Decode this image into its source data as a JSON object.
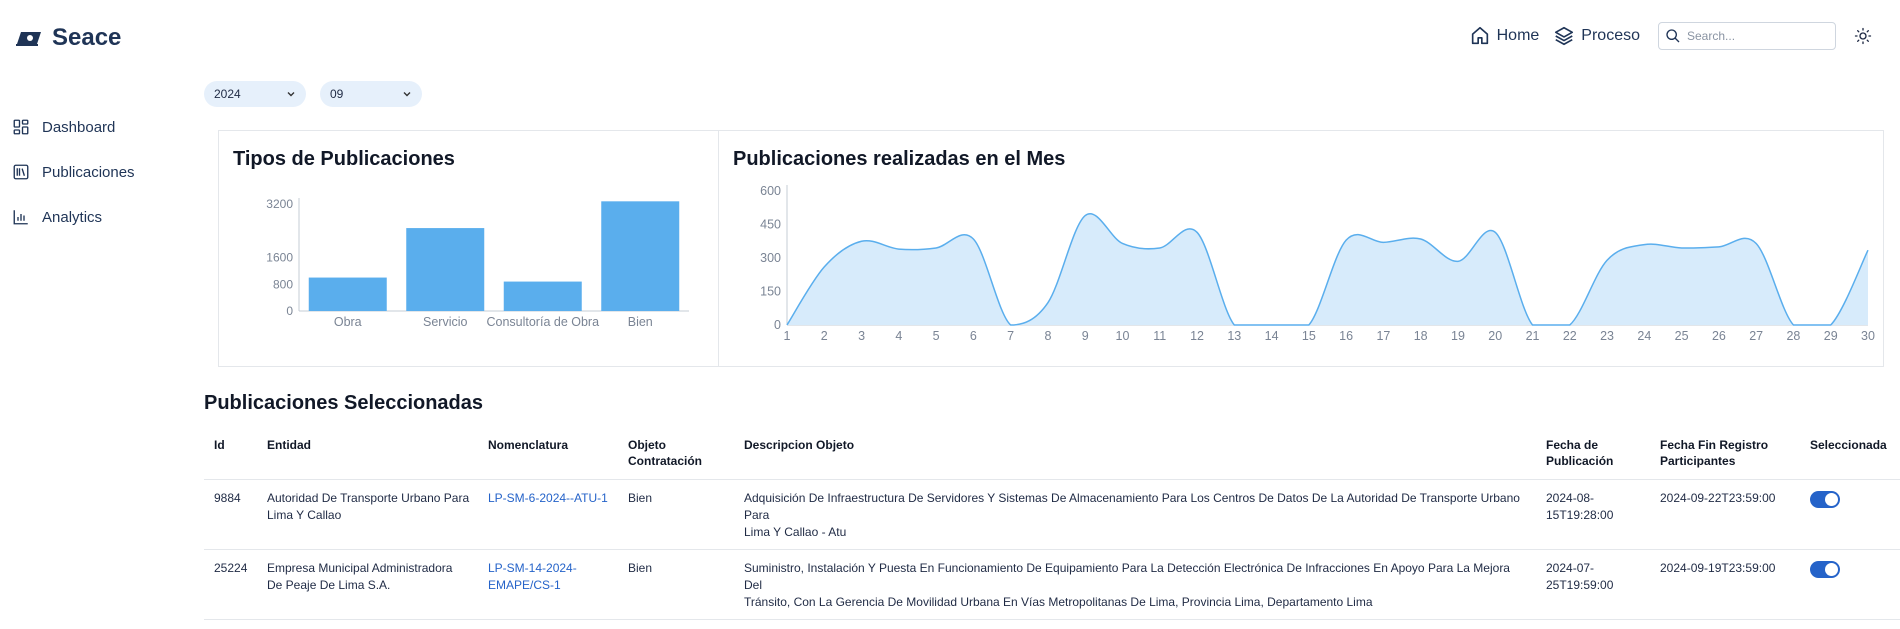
{
  "app": {
    "name": "Seace"
  },
  "topnav": {
    "home_label": "Home",
    "proceso_label": "Proceso",
    "search_placeholder": "Search..."
  },
  "sidebar": {
    "items": [
      {
        "label": "Dashboard",
        "icon": "dashboard-icon"
      },
      {
        "label": "Publicaciones",
        "icon": "library-icon"
      },
      {
        "label": "Analytics",
        "icon": "bar-chart-icon"
      }
    ]
  },
  "filters": {
    "year": "2024",
    "month": "09"
  },
  "colors": {
    "bar": "#5aaeed",
    "area_fill": "#d7ebfb",
    "area_line": "#5aaeed",
    "accent": "#2563c9"
  },
  "chart_data": [
    {
      "type": "bar",
      "title": "Tipos de Publicaciones",
      "categories": [
        "Obra",
        "Servicio",
        "Consultoría de Obra",
        "Bien"
      ],
      "values": [
        1000,
        2480,
        880,
        3280
      ],
      "yticks": [
        0,
        800,
        1600,
        3200
      ],
      "ylim": [
        0,
        3200
      ]
    },
    {
      "type": "area",
      "title": "Publicaciones realizadas en el Mes",
      "x": [
        1,
        2,
        3,
        4,
        5,
        6,
        7,
        8,
        9,
        10,
        11,
        12,
        13,
        14,
        15,
        16,
        17,
        18,
        19,
        20,
        21,
        22,
        23,
        24,
        25,
        26,
        27,
        28,
        29,
        30
      ],
      "values": [
        0,
        260,
        375,
        340,
        345,
        385,
        0,
        100,
        490,
        365,
        345,
        415,
        0,
        0,
        0,
        380,
        370,
        385,
        285,
        415,
        0,
        0,
        290,
        360,
        345,
        350,
        365,
        0,
        0,
        335
      ],
      "yticks": [
        0,
        150,
        300,
        450,
        600
      ],
      "ylim": [
        0,
        600
      ]
    }
  ],
  "table": {
    "title": "Publicaciones Seleccionadas",
    "headers": {
      "id": "Id",
      "entidad": "Entidad",
      "nomenclatura": "Nomenclatura",
      "objeto_1": "Objeto",
      "objeto_2": "Contratación",
      "descripcion": "Descripcion Objeto",
      "fecha_1": "Fecha de",
      "fecha_2": "Publicación",
      "fin_1": "Fecha Fin Registro",
      "fin_2": "Participantes",
      "seleccionada": "Seleccionada"
    },
    "rows": [
      {
        "id": "9884",
        "entidad_1": "Autoridad De Transporte Urbano Para",
        "entidad_2": "Lima Y Callao",
        "nomenclatura_1": "LP-SM-6-2024--ATU-1",
        "nomenclatura_2": "",
        "objeto": "Bien",
        "descripcion_1": "Adquisición De Infraestructura De Servidores Y Sistemas De Almacenamiento Para Los Centros De Datos De La Autoridad De Transporte Urbano Para",
        "descripcion_2": "Lima Y Callao - Atu",
        "fecha_1": "2024-08-",
        "fecha_2": "15T19:28:00",
        "fin": "2024-09-22T23:59:00",
        "seleccionada": true
      },
      {
        "id": "25224",
        "entidad_1": "Empresa Municipal Administradora",
        "entidad_2": "De Peaje De Lima S.A.",
        "nomenclatura_1": "LP-SM-14-2024-",
        "nomenclatura_2": "EMAPE/CS-1",
        "objeto": "Bien",
        "descripcion_1": "Suministro, Instalación Y Puesta En Funcionamiento De Equipamiento Para La Detección Electrónica De Infracciones En Apoyo Para La Mejora Del",
        "descripcion_2": "Tránsito, Con La Gerencia De Movilidad Urbana En Vías Metropolitanas De Lima, Provincia Lima, Departamento Lima",
        "fecha_1": "2024-07-",
        "fecha_2": "25T19:59:00",
        "fin": "2024-09-19T23:59:00",
        "seleccionada": true
      }
    ]
  }
}
